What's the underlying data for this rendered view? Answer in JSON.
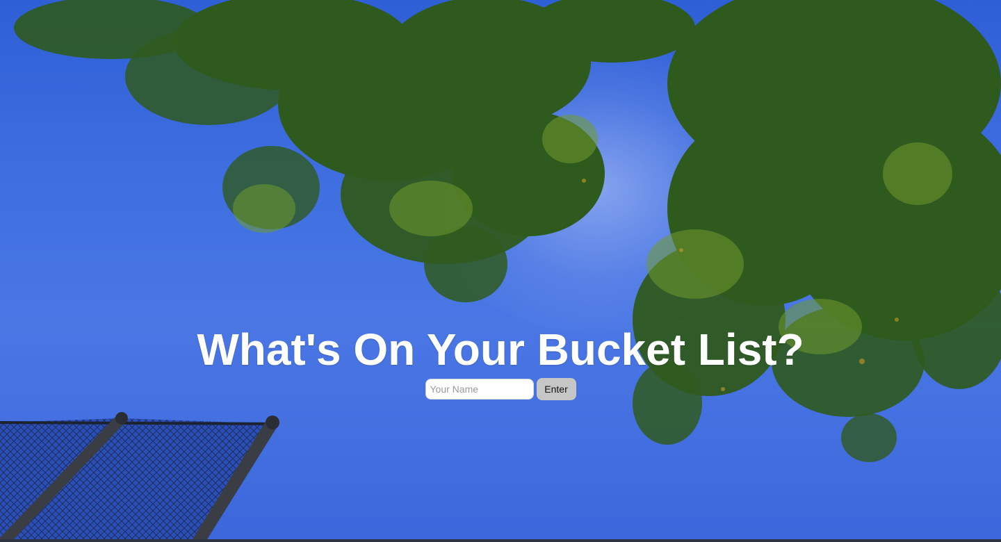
{
  "hero": {
    "title": "What's On Your Bucket List?"
  },
  "form": {
    "name_placeholder": "Your Name",
    "name_value": "",
    "enter_label": "Enter"
  },
  "background": {
    "description_icon": "sky-trees-photo",
    "sky_color": "#3f6fe0",
    "leaf_color": "#2f5a1e"
  }
}
